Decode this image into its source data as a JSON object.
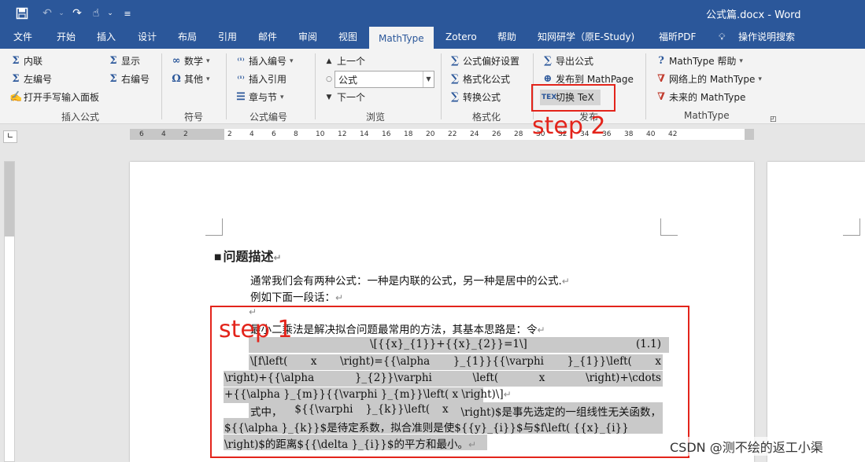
{
  "window": {
    "doc_title": "公式篇.docx  -  Word",
    "qat": {
      "save_icon": "save-icon",
      "undo_icon": "undo-icon",
      "redo_icon": "redo-icon",
      "touch_icon": "touch-mode-icon",
      "customize_icon": "customize-qat-icon"
    }
  },
  "tabs": [
    "文件",
    "开始",
    "插入",
    "设计",
    "布局",
    "引用",
    "邮件",
    "审阅",
    "视图",
    "MathType",
    "Zotero",
    "帮助",
    "知网研学（原E-Study)",
    "福昕PDF",
    "操作说明搜索"
  ],
  "active_tab": "MathType",
  "ribbon": {
    "insert_equation": {
      "label": "插入公式",
      "inline": "内联",
      "display": "显示",
      "left_numbered": "左编号",
      "right_numbered": "右编号",
      "handwriting": "打开手写输入面板"
    },
    "symbols": {
      "label": "符号",
      "math": "数学",
      "other": "其他"
    },
    "equation_numbers": {
      "label": "公式编号",
      "insert_number": "插入编号",
      "insert_reference": "插入引用",
      "chapter_section": "章与节"
    },
    "browse": {
      "label": "浏览",
      "previous": "上一个",
      "select_value": "公式",
      "next": "下一个"
    },
    "format": {
      "label": "格式化",
      "preferences": "公式偏好设置",
      "format_equations": "格式化公式",
      "convert": "转换公式"
    },
    "publish": {
      "label": "发布",
      "export": "导出公式",
      "publish_mathpage": "发布到 MathPage",
      "toggle_tex": "切换 TeX"
    },
    "mathtype": {
      "label": "MathType",
      "help": "MathType 帮助",
      "online": "网络上的 MathType",
      "future": "未来的 MathType"
    }
  },
  "annotations": {
    "step1": "step 1",
    "step2": "step 2"
  },
  "ruler": {
    "numbers": [
      "6",
      "4",
      "2",
      "",
      "2",
      "4",
      "6",
      "8",
      "10",
      "12",
      "14",
      "16",
      "18",
      "20",
      "22",
      "24",
      "26",
      "28",
      "30",
      "32",
      "34",
      "36",
      "38",
      "40",
      "42"
    ]
  },
  "document": {
    "heading": "问题描述",
    "para1": "通常我们会有两种公式：一种是内联的公式，另一种是居中的公式.",
    "para2": "例如下面一段话：",
    "para3": "最小二乘法是解决拟合问题最常用的方法，其基本思路是：令",
    "eq1_code": "\\[{{x}_{1}}+{{x}_{2}}=1\\]",
    "eq1_number": "(1.1)",
    "eq2_row1": [
      "\\[f\\left(",
      "x",
      "\\right)={{\\alpha",
      "}_{1}}{{\\varphi",
      "}_{1}}\\left(",
      "x"
    ],
    "eq2_row2": [
      "\\right)+{{\\alpha",
      "}_{2}}\\varphi",
      "\\left(",
      "x",
      "\\right)+\\cdots"
    ],
    "eq2_row3": "+{{\\alpha }_{m}}{{\\varphi }_{m}}\\left( x \\right)\\]",
    "para4_row1": [
      "式中，",
      "${{\\varphi",
      "}_{k}}\\left(",
      "x",
      "\\right)$是事先选定的一组线性无关函数，"
    ],
    "para4_row2": "${{\\alpha }_{k}}$是待定系数，拟合准则是使${{y}_{i}}$与$f\\left( {{x}_{i}}",
    "para4_row3": "\\right)$的距离${{\\delta }_{i}}$的平方和最小。"
  },
  "watermark": "CSDN @测不绘的返工小渠"
}
